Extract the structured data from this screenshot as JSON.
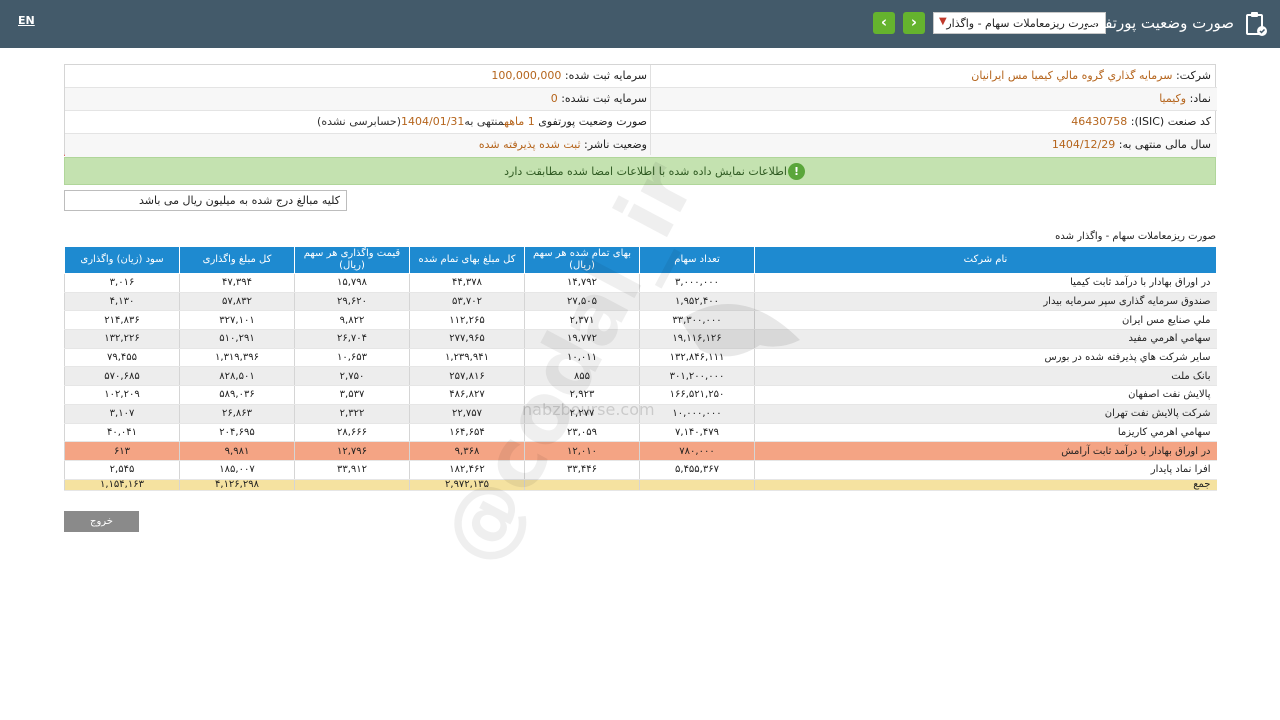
{
  "header": {
    "lang": "EN",
    "title": "صورت وضعیت پورتفوی",
    "select_value": "صورت ریزمعاملات سهام - واگذار",
    "prev_icon": "chevron-left-icon",
    "next_icon": "chevron-right-icon"
  },
  "info": {
    "company_label": "شرکت:",
    "company_value": "سرمایه گذاري گروه مالي كيميا مس ايرانيان",
    "symbol_label": "نماد:",
    "symbol_value": "وکیمیا",
    "isic_label": "کد صنعت (ISIC):",
    "isic_value": "46430758",
    "fiscal_label": "سال مالی منتهی به:",
    "fiscal_value": "1404/12/29",
    "capital_label": "سرمایه ثبت شده:",
    "capital_value": "100,000,000",
    "unreg_label": "سرمایه ثبت نشده:",
    "unreg_value": "0",
    "report_label": "صورت وضعیت پورتفوی",
    "report_period": "1 ماهه",
    "report_end_label": "منتهی به",
    "report_end": "1404/01/31",
    "report_audit": "(حسابرسی نشده)",
    "status_label": "وضعیت ناشر:",
    "status_value": "ثبت شده پذیرفته شده"
  },
  "notice": "اطلاعات نمایش داده شده با اطلاعات امضا شده مطابقت دارد",
  "unit_note": "کلیه مبالغ درج شده به میلیون ریال می باشد",
  "section_title": "صورت ریزمعاملات سهام - واگذار شده",
  "table": {
    "headers": [
      "نام شرکت",
      "تعداد سهام",
      "بهای تمام شده هر سهم (ریال)",
      "کل مبلغ بهای تمام شده",
      "قیمت واگذاری هر سهم (ریال)",
      "کل مبلغ واگذاری",
      "سود (زیان) واگذاری"
    ],
    "rows": [
      [
        "در اوراق بهادار با درآمد ثابت کیمیا",
        "۳,۰۰۰,۰۰۰",
        "۱۴,۷۹۲",
        "۴۴,۳۷۸",
        "۱۵,۷۹۸",
        "۴۷,۳۹۴",
        "۳,۰۱۶"
      ],
      [
        "صندوق سرمایه گذاری سپر سرمایه بیدار",
        "۱,۹۵۲,۴۰۰",
        "۲۷,۵۰۵",
        "۵۳,۷۰۲",
        "۲۹,۶۲۰",
        "۵۷,۸۳۲",
        "۴,۱۳۰"
      ],
      [
        "ملي صنايع مس ايران",
        "۳۳,۳۰۰,۰۰۰",
        "۲,۳۷۱",
        "۱۱۲,۲۶۵",
        "۹,۸۲۲",
        "۳۲۷,۱۰۱",
        "۲۱۴,۸۳۶"
      ],
      [
        "سهامي اهرمي مفيد",
        "۱۹,۱۱۶,۱۲۶",
        "۱۹,۷۷۲",
        "۲۷۷,۹۶۵",
        "۲۶,۷۰۴",
        "۵۱۰,۲۹۱",
        "۱۳۲,۲۲۶"
      ],
      [
        "سایر شرکت هاي پذیرفته شده در بورس",
        "۱۳۲,۸۴۶,۱۱۱",
        "۱۰,۰۱۱",
        "۱,۲۳۹,۹۴۱",
        "۱۰,۶۵۳",
        "۱,۳۱۹,۳۹۶",
        "۷۹,۴۵۵"
      ],
      [
        "بانک ملت",
        "۳۰۱,۲۰۰,۰۰۰",
        "۸۵۵",
        "۲۵۷,۸۱۶",
        "۲,۷۵۰",
        "۸۲۸,۵۰۱",
        "۵۷۰,۶۸۵"
      ],
      [
        "پالایش نفت اصفهان",
        "۱۶۶,۵۲۱,۲۵۰",
        "۲,۹۲۳",
        "۴۸۶,۸۲۷",
        "۳,۵۳۷",
        "۵۸۹,۰۳۶",
        "۱۰۲,۲۰۹"
      ],
      [
        "شرکت پالایش نفت تهران",
        "۱۰,۰۰۰,۰۰۰",
        "۲,۲۷۷",
        "۲۲,۷۵۷",
        "۲,۳۲۲",
        "۲۶,۸۶۳",
        "۳,۱۰۷"
      ],
      [
        "سهامي اهرمي کاریزما",
        "۷,۱۴۰,۴۷۹",
        "۲۳,۰۵۹",
        "۱۶۴,۶۵۴",
        "۲۸,۶۶۶",
        "۲۰۴,۶۹۵",
        "۴۰,۰۴۱"
      ],
      [
        "در اوراق بهادار با درآمد ثابت آرامش",
        "۷۸۰,۰۰۰",
        "۱۲,۰۱۰",
        "۹,۳۶۸",
        "۱۲,۷۹۶",
        "۹,۹۸۱",
        "۶۱۳"
      ],
      [
        "افرا نماد پایدار",
        "۵,۴۵۵,۳۶۷",
        "۳۳,۴۴۶",
        "۱۸۲,۴۶۲",
        "۳۳,۹۱۲",
        "۱۸۵,۰۰۷",
        "۲,۵۴۵"
      ]
    ],
    "highlight_row": 9,
    "total": [
      "جمع",
      "",
      "",
      "۲,۹۷۲,۱۳۵",
      "",
      "۴,۱۲۶,۲۹۸",
      "۱,۱۵۴,۱۶۳"
    ]
  },
  "exit_label": "خروج",
  "watermark": {
    "handle": "@codal_ir",
    "brand": "nabzbourse.com"
  },
  "colors": {
    "topbar": "#435a6a",
    "accent": "#1e8ad0",
    "nav_button": "#65b32e",
    "notice_bg": "#c4e2b0",
    "highlight": "#f4a484",
    "total_bg": "#f5e2a0"
  }
}
